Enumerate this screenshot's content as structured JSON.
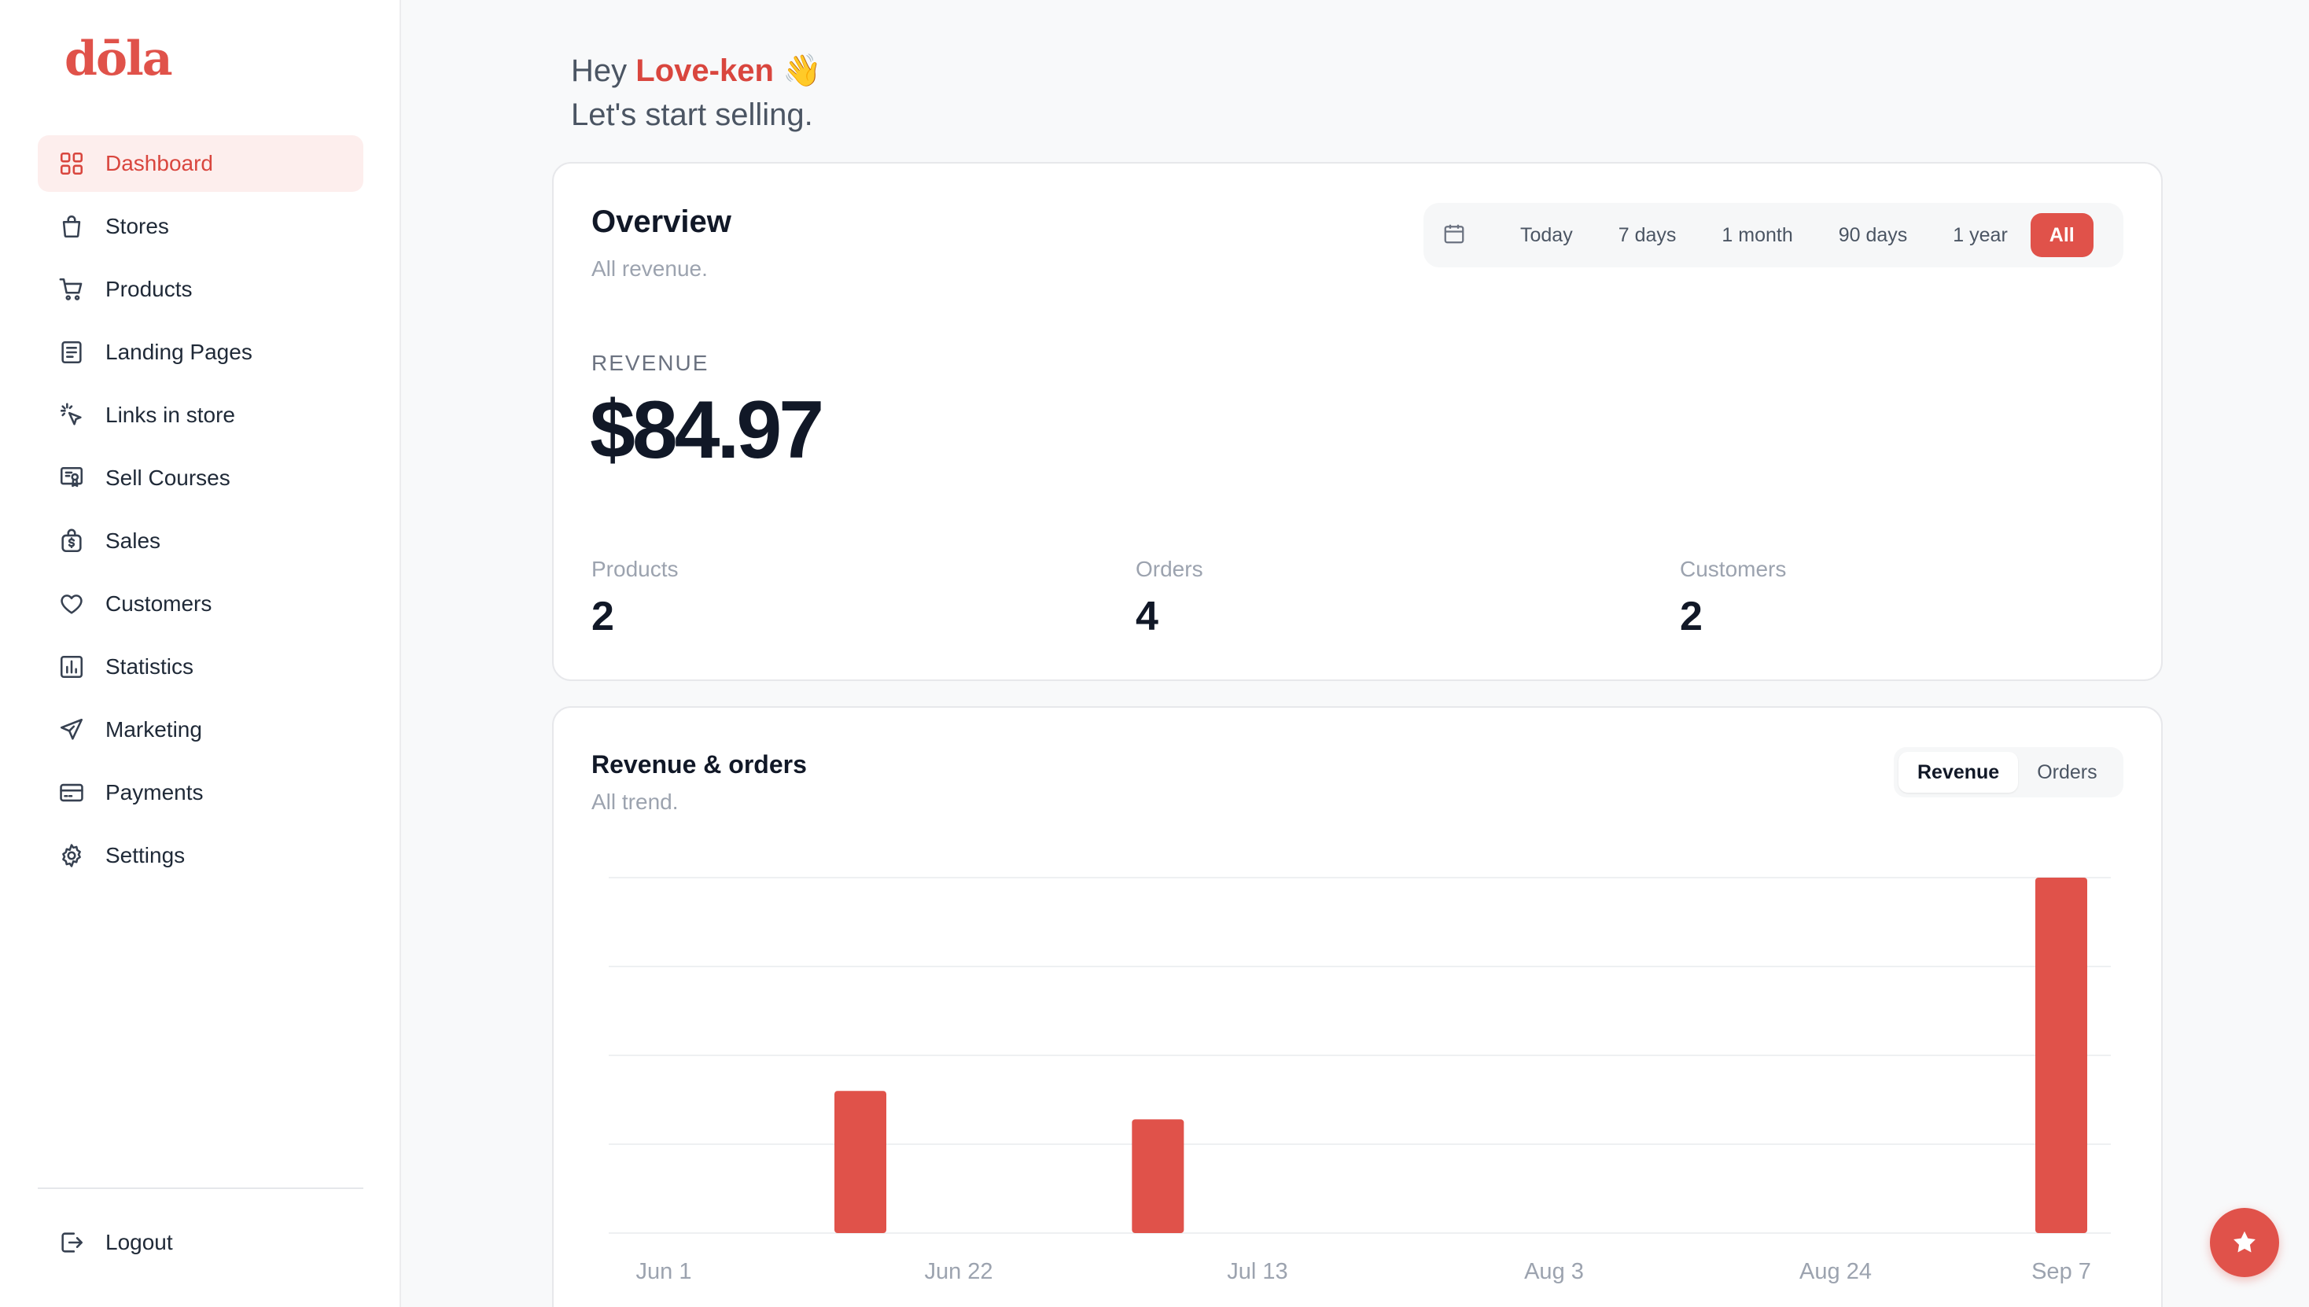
{
  "brand": {
    "logo_text": "dōla",
    "accent": "#e0524a"
  },
  "sidebar": {
    "items": [
      {
        "label": "Dashboard",
        "icon": "grid-icon",
        "active": true
      },
      {
        "label": "Stores",
        "icon": "bag-icon"
      },
      {
        "label": "Products",
        "icon": "cart-icon"
      },
      {
        "label": "Landing Pages",
        "icon": "document-icon"
      },
      {
        "label": "Links in store",
        "icon": "cursor-click-icon"
      },
      {
        "label": "Sell Courses",
        "icon": "certificate-icon"
      },
      {
        "label": "Sales",
        "icon": "money-bag-icon"
      },
      {
        "label": "Customers",
        "icon": "heart-icon"
      },
      {
        "label": "Statistics",
        "icon": "bar-chart-icon"
      },
      {
        "label": "Marketing",
        "icon": "send-icon"
      },
      {
        "label": "Payments",
        "icon": "credit-card-icon"
      },
      {
        "label": "Settings",
        "icon": "gear-icon"
      }
    ],
    "logout": {
      "label": "Logout",
      "icon": "logout-icon"
    }
  },
  "greeting": {
    "hey": "Hey",
    "name": "Love-ken",
    "wave": "👋",
    "subtitle": "Let's start selling."
  },
  "overview": {
    "title": "Overview",
    "subtitle": "All revenue.",
    "ranges": [
      "Today",
      "7 days",
      "1 month",
      "90 days",
      "1 year",
      "All"
    ],
    "active_range": "All",
    "revenue_label": "REVENUE",
    "revenue_value": "$84.97",
    "stats": [
      {
        "label": "Products",
        "value": "2"
      },
      {
        "label": "Orders",
        "value": "4"
      },
      {
        "label": "Customers",
        "value": "2"
      }
    ]
  },
  "trend": {
    "title": "Revenue & orders",
    "subtitle": "All trend.",
    "toggle": [
      "Revenue",
      "Orders"
    ],
    "active_toggle": "Revenue"
  },
  "chart_data": {
    "type": "bar",
    "x_tick_labels": [
      "Jun 1",
      "Jun 22",
      "Jul 13",
      "Aug 3",
      "Aug 24",
      "Sep 7"
    ],
    "bars": [
      {
        "x": "Jun 15",
        "value": 0.4
      },
      {
        "x": "Jul 6",
        "value": 0.32
      },
      {
        "x": "Sep 7",
        "value": 1.0
      }
    ],
    "ylim": [
      0,
      1
    ],
    "grid": true,
    "bar_color": "#e0524a"
  }
}
